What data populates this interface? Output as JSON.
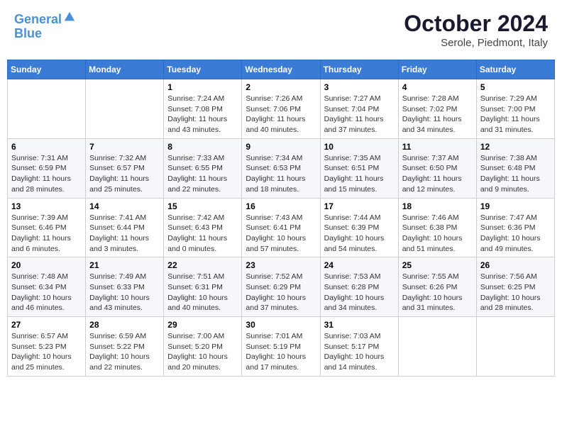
{
  "header": {
    "logo_line1": "General",
    "logo_line2": "Blue",
    "title": "October 2024",
    "subtitle": "Serole, Piedmont, Italy"
  },
  "weekdays": [
    "Sunday",
    "Monday",
    "Tuesday",
    "Wednesday",
    "Thursday",
    "Friday",
    "Saturday"
  ],
  "weeks": [
    [
      {
        "day": "",
        "info": ""
      },
      {
        "day": "",
        "info": ""
      },
      {
        "day": "1",
        "info": "Sunrise: 7:24 AM\nSunset: 7:08 PM\nDaylight: 11 hours and 43 minutes."
      },
      {
        "day": "2",
        "info": "Sunrise: 7:26 AM\nSunset: 7:06 PM\nDaylight: 11 hours and 40 minutes."
      },
      {
        "day": "3",
        "info": "Sunrise: 7:27 AM\nSunset: 7:04 PM\nDaylight: 11 hours and 37 minutes."
      },
      {
        "day": "4",
        "info": "Sunrise: 7:28 AM\nSunset: 7:02 PM\nDaylight: 11 hours and 34 minutes."
      },
      {
        "day": "5",
        "info": "Sunrise: 7:29 AM\nSunset: 7:00 PM\nDaylight: 11 hours and 31 minutes."
      }
    ],
    [
      {
        "day": "6",
        "info": "Sunrise: 7:31 AM\nSunset: 6:59 PM\nDaylight: 11 hours and 28 minutes."
      },
      {
        "day": "7",
        "info": "Sunrise: 7:32 AM\nSunset: 6:57 PM\nDaylight: 11 hours and 25 minutes."
      },
      {
        "day": "8",
        "info": "Sunrise: 7:33 AM\nSunset: 6:55 PM\nDaylight: 11 hours and 22 minutes."
      },
      {
        "day": "9",
        "info": "Sunrise: 7:34 AM\nSunset: 6:53 PM\nDaylight: 11 hours and 18 minutes."
      },
      {
        "day": "10",
        "info": "Sunrise: 7:35 AM\nSunset: 6:51 PM\nDaylight: 11 hours and 15 minutes."
      },
      {
        "day": "11",
        "info": "Sunrise: 7:37 AM\nSunset: 6:50 PM\nDaylight: 11 hours and 12 minutes."
      },
      {
        "day": "12",
        "info": "Sunrise: 7:38 AM\nSunset: 6:48 PM\nDaylight: 11 hours and 9 minutes."
      }
    ],
    [
      {
        "day": "13",
        "info": "Sunrise: 7:39 AM\nSunset: 6:46 PM\nDaylight: 11 hours and 6 minutes."
      },
      {
        "day": "14",
        "info": "Sunrise: 7:41 AM\nSunset: 6:44 PM\nDaylight: 11 hours and 3 minutes."
      },
      {
        "day": "15",
        "info": "Sunrise: 7:42 AM\nSunset: 6:43 PM\nDaylight: 11 hours and 0 minutes."
      },
      {
        "day": "16",
        "info": "Sunrise: 7:43 AM\nSunset: 6:41 PM\nDaylight: 10 hours and 57 minutes."
      },
      {
        "day": "17",
        "info": "Sunrise: 7:44 AM\nSunset: 6:39 PM\nDaylight: 10 hours and 54 minutes."
      },
      {
        "day": "18",
        "info": "Sunrise: 7:46 AM\nSunset: 6:38 PM\nDaylight: 10 hours and 51 minutes."
      },
      {
        "day": "19",
        "info": "Sunrise: 7:47 AM\nSunset: 6:36 PM\nDaylight: 10 hours and 49 minutes."
      }
    ],
    [
      {
        "day": "20",
        "info": "Sunrise: 7:48 AM\nSunset: 6:34 PM\nDaylight: 10 hours and 46 minutes."
      },
      {
        "day": "21",
        "info": "Sunrise: 7:49 AM\nSunset: 6:33 PM\nDaylight: 10 hours and 43 minutes."
      },
      {
        "day": "22",
        "info": "Sunrise: 7:51 AM\nSunset: 6:31 PM\nDaylight: 10 hours and 40 minutes."
      },
      {
        "day": "23",
        "info": "Sunrise: 7:52 AM\nSunset: 6:29 PM\nDaylight: 10 hours and 37 minutes."
      },
      {
        "day": "24",
        "info": "Sunrise: 7:53 AM\nSunset: 6:28 PM\nDaylight: 10 hours and 34 minutes."
      },
      {
        "day": "25",
        "info": "Sunrise: 7:55 AM\nSunset: 6:26 PM\nDaylight: 10 hours and 31 minutes."
      },
      {
        "day": "26",
        "info": "Sunrise: 7:56 AM\nSunset: 6:25 PM\nDaylight: 10 hours and 28 minutes."
      }
    ],
    [
      {
        "day": "27",
        "info": "Sunrise: 6:57 AM\nSunset: 5:23 PM\nDaylight: 10 hours and 25 minutes."
      },
      {
        "day": "28",
        "info": "Sunrise: 6:59 AM\nSunset: 5:22 PM\nDaylight: 10 hours and 22 minutes."
      },
      {
        "day": "29",
        "info": "Sunrise: 7:00 AM\nSunset: 5:20 PM\nDaylight: 10 hours and 20 minutes."
      },
      {
        "day": "30",
        "info": "Sunrise: 7:01 AM\nSunset: 5:19 PM\nDaylight: 10 hours and 17 minutes."
      },
      {
        "day": "31",
        "info": "Sunrise: 7:03 AM\nSunset: 5:17 PM\nDaylight: 10 hours and 14 minutes."
      },
      {
        "day": "",
        "info": ""
      },
      {
        "day": "",
        "info": ""
      }
    ]
  ]
}
